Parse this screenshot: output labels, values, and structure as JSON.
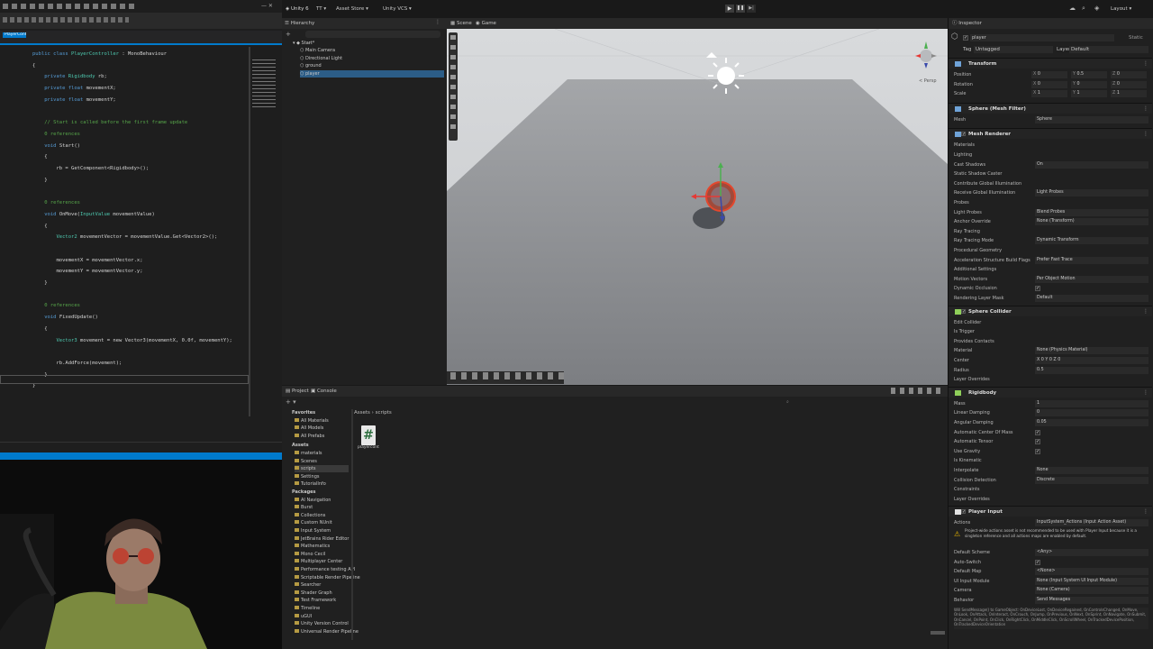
{
  "code_editor": {
    "tab_label": "PlayerControl.cs",
    "lines": [
      {
        "n": "",
        "segs": [
          {
            "c": "kw",
            "t": "public class "
          },
          {
            "c": "ty",
            "t": "PlayerController"
          },
          {
            "c": "",
            "t": " : MonoBehaviour"
          }
        ]
      },
      {
        "n": "",
        "segs": [
          {
            "c": "",
            "t": "{"
          }
        ]
      },
      {
        "n": "",
        "segs": [
          {
            "c": "kw",
            "t": "    private "
          },
          {
            "c": "ty",
            "t": "Rigidbody"
          },
          {
            "c": "",
            "t": " rb;"
          }
        ]
      },
      {
        "n": "",
        "segs": [
          {
            "c": "kw",
            "t": "    private float "
          },
          {
            "c": "",
            "t": "movementX;"
          }
        ]
      },
      {
        "n": "",
        "segs": [
          {
            "c": "kw",
            "t": "    private float "
          },
          {
            "c": "",
            "t": "movementY;"
          }
        ]
      },
      {
        "n": "",
        "segs": [
          {
            "c": "",
            "t": ""
          }
        ]
      },
      {
        "n": "",
        "segs": [
          {
            "c": "cm",
            "t": "    // Start is called before the first frame update"
          }
        ]
      },
      {
        "n": "",
        "segs": [
          {
            "c": "cm",
            "t": "    0 references"
          }
        ]
      },
      {
        "n": "",
        "segs": [
          {
            "c": "kw",
            "t": "    void "
          },
          {
            "c": "",
            "t": "Start()"
          }
        ]
      },
      {
        "n": "",
        "segs": [
          {
            "c": "",
            "t": "    {"
          }
        ]
      },
      {
        "n": "",
        "segs": [
          {
            "c": "",
            "t": "        rb = GetComponent<Rigidbody>();"
          }
        ]
      },
      {
        "n": "",
        "segs": [
          {
            "c": "",
            "t": "    }"
          }
        ]
      },
      {
        "n": "",
        "segs": [
          {
            "c": "",
            "t": ""
          }
        ]
      },
      {
        "n": "",
        "segs": [
          {
            "c": "cm",
            "t": "    0 references"
          }
        ]
      },
      {
        "n": "",
        "segs": [
          {
            "c": "kw",
            "t": "    void "
          },
          {
            "c": "",
            "t": "OnMove("
          },
          {
            "c": "ty",
            "t": "InputValue"
          },
          {
            "c": "",
            "t": " movementValue)"
          }
        ]
      },
      {
        "n": "",
        "segs": [
          {
            "c": "",
            "t": "    {"
          }
        ]
      },
      {
        "n": "",
        "segs": [
          {
            "c": "ty",
            "t": "        Vector2"
          },
          {
            "c": "",
            "t": " movementVector = movementValue.Get<Vector2>();"
          }
        ]
      },
      {
        "n": "",
        "segs": [
          {
            "c": "",
            "t": ""
          }
        ]
      },
      {
        "n": "",
        "segs": [
          {
            "c": "",
            "t": "        movementX = movementVector.x;"
          }
        ]
      },
      {
        "n": "",
        "segs": [
          {
            "c": "",
            "t": "        movementY = movementVector.y;"
          }
        ]
      },
      {
        "n": "",
        "segs": [
          {
            "c": "",
            "t": "    }"
          }
        ]
      },
      {
        "n": "",
        "segs": [
          {
            "c": "",
            "t": ""
          }
        ]
      },
      {
        "n": "",
        "segs": [
          {
            "c": "cm",
            "t": "    0 references"
          }
        ]
      },
      {
        "n": "",
        "segs": [
          {
            "c": "kw",
            "t": "    void "
          },
          {
            "c": "",
            "t": "FixedUpdate()"
          }
        ]
      },
      {
        "n": "",
        "segs": [
          {
            "c": "",
            "t": "    {"
          }
        ]
      },
      {
        "n": "",
        "segs": [
          {
            "c": "ty",
            "t": "        Vector3"
          },
          {
            "c": "",
            "t": " movement = new Vector3(movementX, 0.0f, movementY);"
          }
        ]
      },
      {
        "n": "",
        "segs": [
          {
            "c": "",
            "t": ""
          }
        ]
      },
      {
        "n": "",
        "segs": [
          {
            "c": "",
            "t": "        rb.AddForce(movement);"
          }
        ]
      },
      {
        "n": "",
        "segs": [
          {
            "c": "",
            "t": "    }"
          }
        ]
      },
      {
        "n": "",
        "segs": [
          {
            "c": "",
            "t": "}"
          }
        ]
      }
    ]
  },
  "toolbar": {
    "project": "Unity 6",
    "account": "TT",
    "asset_store": "Asset Store",
    "vcs": "Unity VCS",
    "layout": "Layout"
  },
  "hierarchy": {
    "tab": "Hierarchy",
    "scene": "Start*",
    "items": [
      "Main Camera",
      "Directional Light",
      "ground",
      "player"
    ]
  },
  "scene_view": {
    "tab_scene": "Scene",
    "tab_game": "Game",
    "persp": "< Persp"
  },
  "project": {
    "tab_project": "Project",
    "tab_console": "Console",
    "breadcrumb": [
      "Assets",
      "scripts"
    ],
    "favorites": [
      "Favorites",
      "All Materials",
      "All Models",
      "All Prefabs"
    ],
    "assets": [
      "Assets",
      "materials",
      "Scenes",
      "scripts",
      "Settings",
      "TutorialInfo"
    ],
    "packages": [
      "Packages",
      "AI Navigation",
      "Burst",
      "Collections",
      "Custom NUnit",
      "Input System",
      "JetBrains Rider Editor",
      "Mathematics",
      "Mono Cecil",
      "Multiplayer Center",
      "Performance testing API",
      "Scriptable Render Pipeline",
      "Searcher",
      "Shader Graph",
      "Test Framework",
      "Timeline",
      "uGUI",
      "Unity Version Control",
      "Universal Render Pipeline"
    ],
    "file_name": "playercontr..."
  },
  "inspector": {
    "tab": "Inspector",
    "name": "player",
    "tag_label": "Tag",
    "tag": "Untagged",
    "layer_label": "Layer",
    "layer": "Default",
    "static": "Static",
    "transform": {
      "title": "Transform",
      "rows": [
        {
          "label": "Position",
          "x": "0",
          "y": "0.5",
          "z": "0"
        },
        {
          "label": "Rotation",
          "x": "0",
          "y": "0",
          "z": "0"
        },
        {
          "label": "Scale",
          "x": "1",
          "y": "1",
          "z": "1"
        }
      ]
    },
    "mesh_filter": {
      "title": "Sphere (Mesh Filter)",
      "mesh_label": "Mesh",
      "mesh": "Sphere"
    },
    "mesh_renderer": {
      "title": "Mesh Renderer",
      "rows": [
        {
          "label": "Materials",
          "value": ""
        },
        {
          "label": "Lighting",
          "value": ""
        },
        {
          "label": "Cast Shadows",
          "value": "On"
        },
        {
          "label": "Static Shadow Caster",
          "value": ""
        },
        {
          "label": "Contribute Global Illumination",
          "value": ""
        },
        {
          "label": "Receive Global Illumination",
          "value": "Light Probes"
        },
        {
          "label": "Probes",
          "value": ""
        },
        {
          "label": "Light Probes",
          "value": "Blend Probes"
        },
        {
          "label": "Anchor Override",
          "value": "None (Transform)"
        },
        {
          "label": "Ray Tracing",
          "value": ""
        },
        {
          "label": "Ray Tracing Mode",
          "value": "Dynamic Transform"
        },
        {
          "label": "Procedural Geometry",
          "value": ""
        },
        {
          "label": "Acceleration Structure Build Flags",
          "value": "Prefer Fast Trace"
        },
        {
          "label": "Additional Settings",
          "value": ""
        },
        {
          "label": "Motion Vectors",
          "value": "Per Object Motion"
        },
        {
          "label": "Dynamic Occlusion",
          "value": "✓"
        },
        {
          "label": "Rendering Layer Mask",
          "value": "Default"
        }
      ]
    },
    "sphere_collider": {
      "title": "Sphere Collider",
      "rows": [
        {
          "label": "Edit Collider",
          "value": ""
        },
        {
          "label": "Is Trigger",
          "value": ""
        },
        {
          "label": "Provides Contacts",
          "value": ""
        },
        {
          "label": "Material",
          "value": "None (Physics Material)"
        },
        {
          "label": "Center",
          "value": "X 0      Y 0      Z 0"
        },
        {
          "label": "Radius",
          "value": "0.5"
        },
        {
          "label": "Layer Overrides",
          "value": ""
        }
      ]
    },
    "rigidbody": {
      "title": "Rigidbody",
      "rows": [
        {
          "label": "Mass",
          "value": "1"
        },
        {
          "label": "Linear Damping",
          "value": "0"
        },
        {
          "label": "Angular Damping",
          "value": "0.05"
        },
        {
          "label": "Automatic Center Of Mass",
          "value": "✓"
        },
        {
          "label": "Automatic Tensor",
          "value": "✓"
        },
        {
          "label": "Use Gravity",
          "value": "✓"
        },
        {
          "label": "Is Kinematic",
          "value": ""
        },
        {
          "label": "Interpolate",
          "value": "None"
        },
        {
          "label": "Collision Detection",
          "value": "Discrete"
        },
        {
          "label": "Constraints",
          "value": ""
        },
        {
          "label": "Layer Overrides",
          "value": ""
        }
      ]
    },
    "player_input": {
      "title": "Player Input",
      "rows": [
        {
          "label": "Actions",
          "value": "InputSystem_Actions (Input Action Asset)"
        },
        {
          "label": "Default Scheme",
          "value": "<Any>"
        },
        {
          "label": "Auto-Switch",
          "value": "✓"
        },
        {
          "label": "Default Map",
          "value": "<None>"
        },
        {
          "label": "UI Input Module",
          "value": "None (Input System UI Input Module)"
        },
        {
          "label": "Camera",
          "value": "None (Camera)"
        },
        {
          "label": "Behavior",
          "value": "Send Messages"
        }
      ],
      "warning": "Project-wide actions asset is not recommended to be used with Player Input because it is a singleton reference and all actions maps are enabled by default.",
      "footer": "Will SendMessage() to GameObject: OnDeviceLost, OnDeviceRegained, OnControlsChanged, OnMove, OnLook, OnAttack, OnInteract, OnCrouch, OnJump, OnPrevious, OnNext, OnSprint, OnNavigate, OnSubmit, OnCancel, OnPoint, OnClick, OnRightClick, OnMiddleClick, OnScrollWheel, OnTrackedDevicePosition, OnTrackedDeviceOrientation"
    }
  },
  "colors": {
    "accent": "#3a79bb",
    "selection": "#2c5d87",
    "code_blue": "#007acc"
  }
}
